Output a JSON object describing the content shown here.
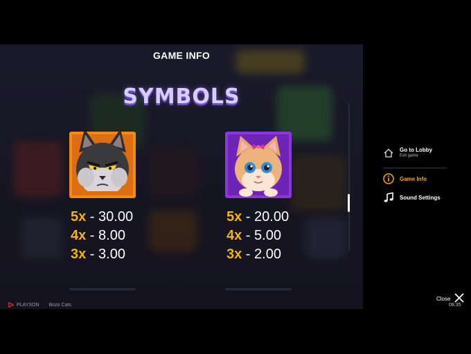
{
  "header": {
    "title": "GAME INFO"
  },
  "section": {
    "title": "SYMBOLS"
  },
  "symbols": [
    {
      "name": "black cat",
      "frame_color": "#f08a1a",
      "pays": [
        {
          "mult": "5x",
          "sep": " - ",
          "value": "30.00"
        },
        {
          "mult": "4x",
          "sep": " - ",
          "value": "8.00"
        },
        {
          "mult": "3x",
          "sep": " - ",
          "value": "3.00"
        }
      ]
    },
    {
      "name": "ginger kitten",
      "frame_color": "#8a38d6",
      "pays": [
        {
          "mult": "5x",
          "sep": " - ",
          "value": "20.00"
        },
        {
          "mult": "4x",
          "sep": " - ",
          "value": "5.00"
        },
        {
          "mult": "3x",
          "sep": " - ",
          "value": "2.00"
        }
      ]
    }
  ],
  "brand": {
    "provider": "PLAYSON",
    "game": "Bozo Cats"
  },
  "menu": {
    "lobby": {
      "label": "Go to Lobby",
      "sub": "Exit game",
      "icon": "home-icon"
    },
    "game_info": {
      "label": "Game Info",
      "icon": "info-icon"
    },
    "sound": {
      "label": "Sound Settings",
      "icon": "music-note-icon"
    }
  },
  "close": {
    "label": "Close",
    "icon": "close-icon"
  },
  "clock": {
    "time": "08:35"
  },
  "colors": {
    "accent": "#f5a623",
    "multiplier": "#f5b400",
    "title_glow": "#6c4fc6"
  }
}
